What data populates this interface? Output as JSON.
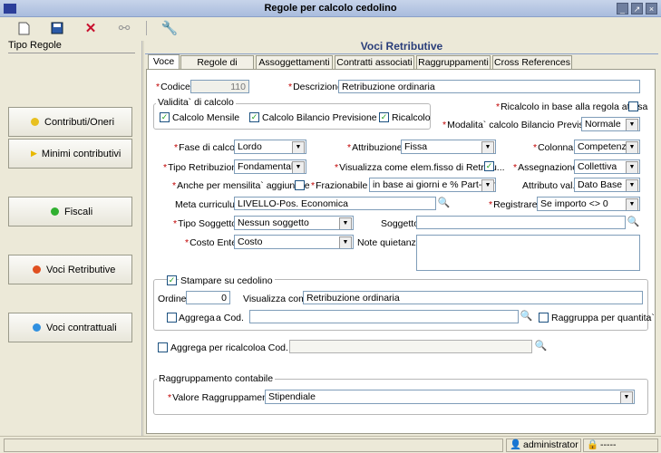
{
  "window": {
    "title": "Regole per calcolo cedolino",
    "min": "_",
    "max": "↗",
    "close": "×"
  },
  "toolbar": {
    "new": "new-doc-icon",
    "save": "save-icon",
    "delete": "delete-icon",
    "link": "link-icon",
    "tools": "wrench-icon"
  },
  "left": {
    "header": "Tipo Regole",
    "buttons": [
      {
        "label": "Contributi/Oneri",
        "color": "#e8c020"
      },
      {
        "label": "Minimi contributivi",
        "color": "#e8b800"
      },
      {
        "label": "Fiscali",
        "color": "#30b030"
      },
      {
        "label": "Voci Retributive",
        "color": "#e05020"
      },
      {
        "label": "Voci contrattuali",
        "color": "#3090e0"
      }
    ]
  },
  "section": {
    "title": "Voci Retributive"
  },
  "tabs": [
    "Voce",
    "Regole di calcolo",
    "Assoggettamenti",
    "Contratti associati",
    "Raggruppamenti",
    "Cross References"
  ],
  "form": {
    "codice_label": "Codice",
    "codice": "110",
    "descr_label": "Descrizione",
    "descr": "Retribuzione ordinaria",
    "validita_label": "Validita` di calcolo",
    "cb_mensile": "Calcolo Mensile",
    "cb_bilancio": "Calcolo Bilancio Previsione",
    "cb_ricalcolo": "Ricalcolo",
    "ricalcolo_attesa": "Ricalcolo in base alla regola attesa",
    "modalita_label": "Modalita` calcolo Bilancio Previsione",
    "modalita": "Normale",
    "fase_label": "Fase di calcolo",
    "fase": "Lordo",
    "attrib_label": "Attribuzione",
    "attrib": "Fissa",
    "colonna_label": "Colonna",
    "colonna": "Competenza",
    "tipo_retr_label": "Tipo Retribuzione",
    "tipo_retr": "Fondamentale",
    "visualizza_label": "Visualizza come elem.fisso di Retribu...",
    "assegn_label": "Assegnazione",
    "assegn": "Collettiva",
    "anche_label": "Anche per mensilita` aggiuntive",
    "frazion_label": "Frazionabile",
    "frazion": "in base ai giorni e % Part-Time",
    "attr_val_label": "Attributo val.",
    "attr_val": "Dato Base",
    "meta_label": "Meta curriculum",
    "meta": "LIVELLO-Pos. Economica",
    "registrare_label": "Registrare",
    "registrare": "Se importo <> 0",
    "tipo_sogg_label": "Tipo Soggetto",
    "tipo_sogg": "Nessun soggetto",
    "soggetto_label": "Soggetto",
    "costo_label": "Costo Ente",
    "costo": "Costo",
    "note_label": "Note quietanza",
    "stampare_label": "Stampare su cedolino",
    "ordine_label": "Ordine",
    "ordine": "0",
    "visualizza_come_label": "Visualizza come",
    "visualizza_come": "Retribuzione ordinaria",
    "aggrega_label": "Aggrega",
    "acod_label": "a Cod.",
    "raggruppa_label": "Raggruppa per quantita`",
    "aggrega_ric_label": "Aggrega per ricalcolo",
    "acod2_label": "a Cod.",
    "ragg_cont_label": "Raggruppamento contabile",
    "valore_ragg_label": "Valore Raggruppamento",
    "valore_ragg": "Stipendiale"
  },
  "status": {
    "user": "administrator",
    "other": "-----"
  }
}
